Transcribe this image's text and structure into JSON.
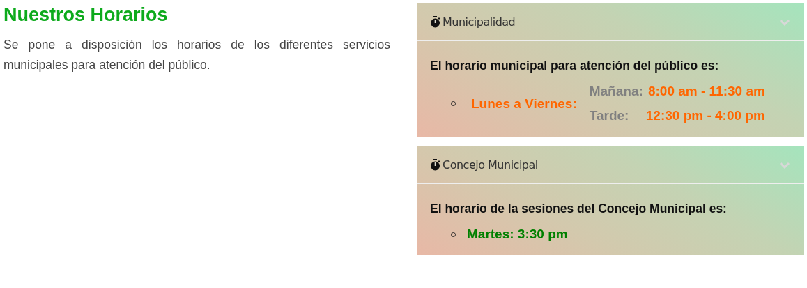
{
  "title": "Nuestros Horarios",
  "intro": "Se pone a disposición los horarios de los diferentes servicios municipales para atención del público.",
  "panels": [
    {
      "title": "Municipalidad",
      "expanded": true,
      "heading": "El horario municipal para atención del público es:",
      "items": [
        {
          "kind": "schedule",
          "label": "Lunes a Viernes:",
          "color": "#ff6600",
          "rows": [
            {
              "name": "Mañana:",
              "time": "8:00 am - 11:30 am"
            },
            {
              "name": "Tarde:",
              "time": "12:30 pm - 4:00 pm"
            }
          ]
        }
      ]
    },
    {
      "title": "Concejo Municipal",
      "expanded": true,
      "heading": "El horario de la sesiones del Concejo Municipal es:",
      "items": [
        {
          "kind": "simple",
          "label": "Martes: 3:30 pm",
          "color": "#008000"
        }
      ]
    }
  ]
}
